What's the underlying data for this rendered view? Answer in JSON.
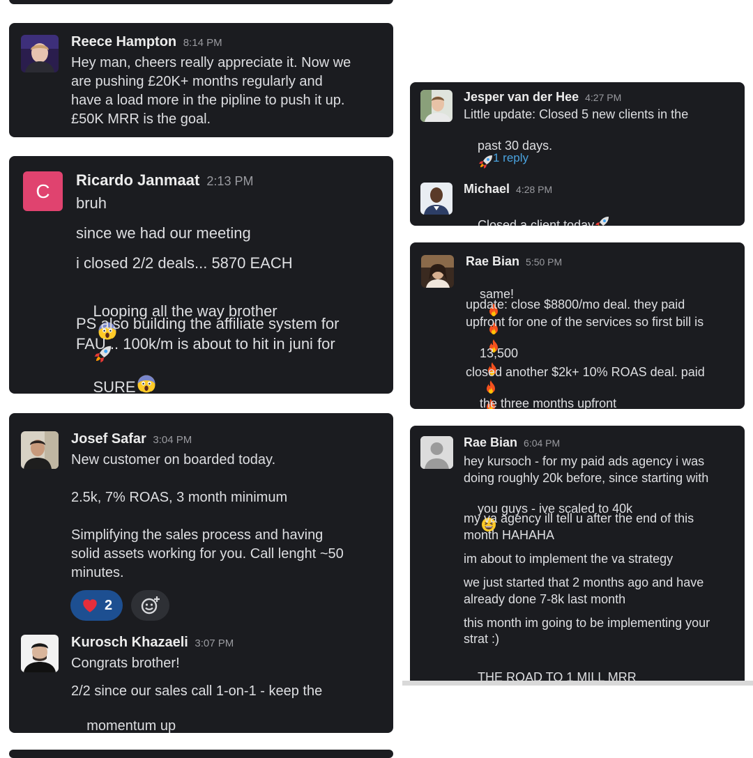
{
  "left_column": {
    "reece": {
      "name": "Reece Hampton",
      "time": "8:14 PM",
      "lines": [
        "Hey man, cheers really appreciate it. Now we",
        "are pushing £20K+ months regularly and",
        "have a load more in the pipline to push it up.",
        "£50K MRR is the goal."
      ]
    },
    "ricardo": {
      "avatar_letter": "C",
      "avatar_color": "#e0436f",
      "name": "Ricardo Janmaat",
      "time": "2:13 PM",
      "lines": [
        "bruh",
        "since we had our meeting",
        "i closed 2/2 deals... 5870 EACH",
        "Looping all the way brother",
        "PS also building the affiliate system for",
        "FAU... 100k/m is about to hit in juni for",
        "SURE"
      ]
    },
    "josef": {
      "name": "Josef Safar",
      "time": "3:04 PM",
      "lines": [
        "New customer on boarded today.",
        "2.5k, 7% ROAS, 3 month minimum",
        "Simplifying the sales process and having",
        "solid assets working for you. Call lenght ~50",
        "minutes."
      ],
      "reaction_count": "2"
    },
    "kurosch": {
      "name": "Kurosch Khazaeli",
      "time": "3:07 PM",
      "lines": [
        "Congrats brother!",
        "2/2 since our sales call 1-on-1 - keep the",
        "momentum up"
      ]
    }
  },
  "right_column": {
    "jesper": {
      "name": "Jesper van der Hee",
      "time": "4:27 PM",
      "lines": [
        "Little update: Closed 5 new clients in the",
        "past 30 days."
      ],
      "reply_label": "1 reply"
    },
    "michael": {
      "name": "Michael",
      "time": "4:28 PM",
      "lines": [
        "Closed a client today"
      ]
    },
    "rae1": {
      "name": "Rae Bian",
      "time": "5:50 PM",
      "lines": [
        "same!",
        "update: close $8800/mo deal. they paid",
        "upfront for one of the services so first bill is",
        "13,500",
        "closed another $2k+ 10% ROAS deal. paid",
        "the three months upfront"
      ]
    },
    "rae2": {
      "name": "Rae Bian",
      "time": "6:04 PM",
      "lines": [
        "hey kursoch - for my paid ads agency i was",
        "doing roughly 20k before, since starting with",
        "you guys - ive scaled to 40k",
        "my va agency ill tell u after the end of this",
        "month HAHAHA",
        "im about to implement the va strategy",
        "we just started that 2 months ago and have",
        "already done 7-8k last month",
        "this month im going to be implementing your",
        "strat :)",
        "THE ROAD TO 1 MILL MRR"
      ]
    }
  },
  "colors": {
    "card_bg": "#1b1c20",
    "link": "#4aa3df",
    "reaction_active": "#1d4f91",
    "reaction_idle": "#2e3035"
  },
  "icons": [
    "rocket-icon",
    "scream-emoji-icon",
    "fire-icon",
    "heart-icon",
    "add-reaction-icon",
    "grin-squint-emoji-icon",
    "rofl-emoji-icon",
    "ok-hand-icon",
    "default-user-icon"
  ]
}
